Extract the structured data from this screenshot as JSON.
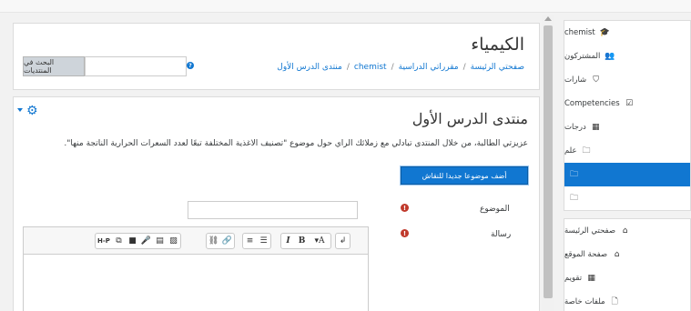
{
  "header": {
    "course_title": "الكيمياء",
    "breadcrumb": [
      "صفحتي الرئيسة",
      "مقرراتي الدراسية",
      "chemist",
      "منتدى الدرس الأول"
    ],
    "search_button": "البحث في المنتديات",
    "search_value": ""
  },
  "forum": {
    "title": "منتدى الدرس الأول",
    "description": "عزيزتي الطالبة، من خلال المنتدى تبادلي مع زملائك الرأي حول موضوع \"تصنيف الأغذية المختلفة تبعًا لعدد السعرات الحرارية الناتجة منها\".",
    "add_topic_button": "أضف موضوعا جديدا للنقاش",
    "subject_label": "الموضوع",
    "subject_value": "",
    "message_label": "رسالة"
  },
  "editor": {
    "toolbar_groups": [
      [
        "H-P",
        "⧉",
        "■",
        "🎤",
        "▤",
        "▨"
      ],
      [
        "⛓",
        "🔗"
      ],
      [
        "≡",
        "☰"
      ],
      [
        "I",
        "B",
        "▾A"
      ],
      [
        "↲"
      ]
    ]
  },
  "sidebar": {
    "course_nav": [
      {
        "label": "chemist",
        "icon": "graduation-cap-icon",
        "glyph": "🎓"
      },
      {
        "label": "المشتركون",
        "icon": "users-icon",
        "glyph": "👥"
      },
      {
        "label": "شارات",
        "icon": "shield-icon",
        "glyph": "⛉"
      },
      {
        "label": "Competencies",
        "icon": "checkbox-icon",
        "glyph": "☑"
      },
      {
        "label": "درجات",
        "icon": "table-icon",
        "glyph": "▦"
      },
      {
        "label": "علم",
        "icon": "folder-icon",
        "glyph": "🗀"
      },
      {
        "label": "",
        "icon": "folder-icon",
        "glyph": "🗀"
      },
      {
        "label": "",
        "icon": "folder-icon",
        "glyph": "🗀"
      }
    ],
    "site_nav": [
      {
        "label": "صفحتي الرئيسة",
        "icon": "dashboard-icon",
        "glyph": "⌂"
      },
      {
        "label": "صفحة الموقع",
        "icon": "home-icon",
        "glyph": "⌂"
      },
      {
        "label": "تقويم",
        "icon": "calendar-icon",
        "glyph": "▦"
      },
      {
        "label": "ملفات خاصة",
        "icon": "file-icon",
        "glyph": "🗋"
      }
    ]
  },
  "colors": {
    "accent": "#1177d1",
    "required": "#c0392b"
  }
}
